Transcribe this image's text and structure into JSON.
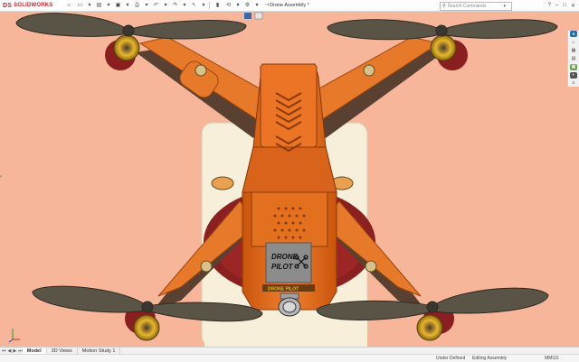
{
  "app": {
    "brand": "SOLIDWORKS",
    "brand_mark": "DS"
  },
  "document": {
    "title": "Drone Assembly *"
  },
  "search": {
    "placeholder": "Search Commands"
  },
  "toolbar": {
    "icons": [
      "home-icon",
      "new-file-icon",
      "open-file-icon",
      "save-icon",
      "print-icon",
      "undo-icon",
      "redo-icon",
      "select-icon",
      "rebuild-icon",
      "options-icon"
    ]
  },
  "window_controls": {
    "help": "?",
    "minimize": "–",
    "restore": "□",
    "close": "✕"
  },
  "bottom_tabs": [
    {
      "label": "Model",
      "active": true
    },
    {
      "label": "3D Views",
      "active": false
    },
    {
      "label": "Motion Study 1",
      "active": false
    }
  ],
  "status_bar": {
    "definition": "Under Defined",
    "mode": "Editing Assembly",
    "units": "MMGS"
  },
  "drone": {
    "badge_line1": "DRONE",
    "badge_line2": "PILOT",
    "strip_text": "DRONE PILOT"
  },
  "colors": {
    "background": "#f7b599",
    "body": "#e36b17",
    "body_dark": "#b94a0a",
    "arm": "#e67a2a",
    "prop": "#5a5446",
    "motor": "#e8b62c",
    "base": "#f7efd9"
  }
}
